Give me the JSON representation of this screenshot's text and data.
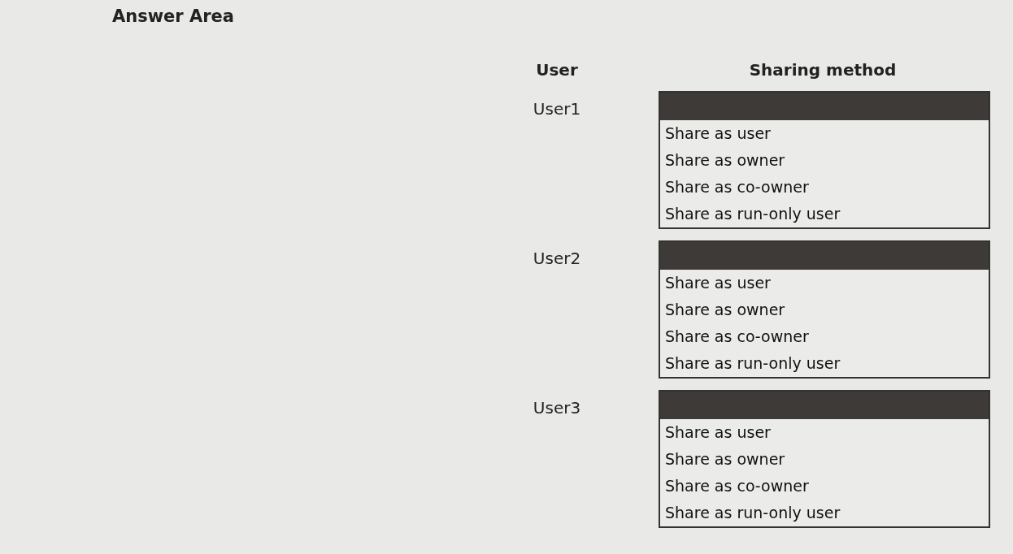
{
  "title": "Answer Area",
  "columns": [
    "User",
    "Sharing method"
  ],
  "rows": [
    {
      "user": "User1",
      "options": [
        "Share as user",
        "Share as owner",
        "Share as co-owner",
        "Share as run-only user"
      ]
    },
    {
      "user": "User2",
      "options": [
        "Share as user",
        "Share as owner",
        "Share as co-owner",
        "Share as run-only user"
      ]
    },
    {
      "user": "User3",
      "options": [
        "Share as user",
        "Share as owner",
        "Share as co-owner",
        "Share as run-only user"
      ]
    }
  ]
}
